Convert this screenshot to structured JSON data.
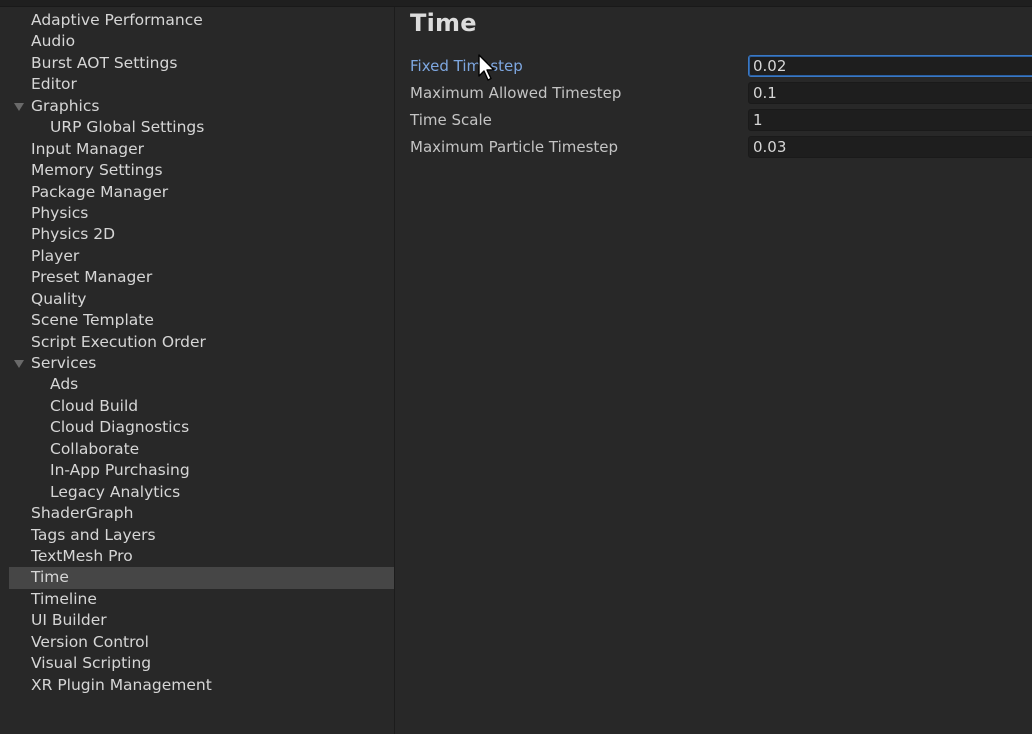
{
  "sidebar": {
    "items": [
      {
        "label": "Adaptive Performance"
      },
      {
        "label": "Audio"
      },
      {
        "label": "Burst AOT Settings"
      },
      {
        "label": "Editor"
      },
      {
        "label": "Graphics"
      },
      {
        "label": "URP Global Settings"
      },
      {
        "label": "Input Manager"
      },
      {
        "label": "Memory Settings"
      },
      {
        "label": "Package Manager"
      },
      {
        "label": "Physics"
      },
      {
        "label": "Physics 2D"
      },
      {
        "label": "Player"
      },
      {
        "label": "Preset Manager"
      },
      {
        "label": "Quality"
      },
      {
        "label": "Scene Template"
      },
      {
        "label": "Script Execution Order"
      },
      {
        "label": "Services"
      },
      {
        "label": "Ads"
      },
      {
        "label": "Cloud Build"
      },
      {
        "label": "Cloud Diagnostics"
      },
      {
        "label": "Collaborate"
      },
      {
        "label": "In-App Purchasing"
      },
      {
        "label": "Legacy Analytics"
      },
      {
        "label": "ShaderGraph"
      },
      {
        "label": "Tags and Layers"
      },
      {
        "label": "TextMesh Pro"
      },
      {
        "label": "Time"
      },
      {
        "label": "Timeline"
      },
      {
        "label": "UI Builder"
      },
      {
        "label": "Version Control"
      },
      {
        "label": "Visual Scripting"
      },
      {
        "label": "XR Plugin Management"
      }
    ],
    "selected": "Time"
  },
  "page": {
    "title": "Time"
  },
  "settings": [
    {
      "label": "Fixed Timestep",
      "value": "0.02"
    },
    {
      "label": "Maximum Allowed Timestep",
      "value": "0.1"
    },
    {
      "label": "Time Scale",
      "value": "1"
    },
    {
      "label": "Maximum Particle Timestep",
      "value": "0.03"
    }
  ],
  "colors": {
    "background": "#282828",
    "selected_row": "#464646",
    "active_label": "#7ea7e0",
    "focus_border": "#3a78c4"
  },
  "icons": {
    "fold": "triangle-down-icon",
    "cursor": "mouse-pointer-icon"
  }
}
